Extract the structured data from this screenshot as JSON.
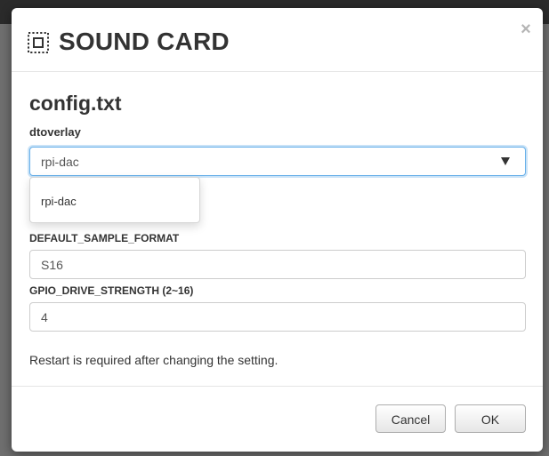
{
  "dialog": {
    "title": "SOUND CARD",
    "icon": "chip-icon",
    "close_label": "×"
  },
  "config": {
    "heading": "config.txt",
    "dtoverlay": {
      "label": "dtoverlay",
      "selected": "rpi-dac",
      "options": [
        "rpi-dac"
      ]
    },
    "default_sample_format": {
      "label": "DEFAULT_SAMPLE_FORMAT",
      "value": "S16"
    },
    "gpio_drive_strength": {
      "label": "GPIO_DRIVE_STRENGTH (2~16)",
      "value": "4"
    },
    "notice": "Restart is required after changing the setting."
  },
  "footer": {
    "cancel_label": "Cancel",
    "ok_label": "OK"
  }
}
